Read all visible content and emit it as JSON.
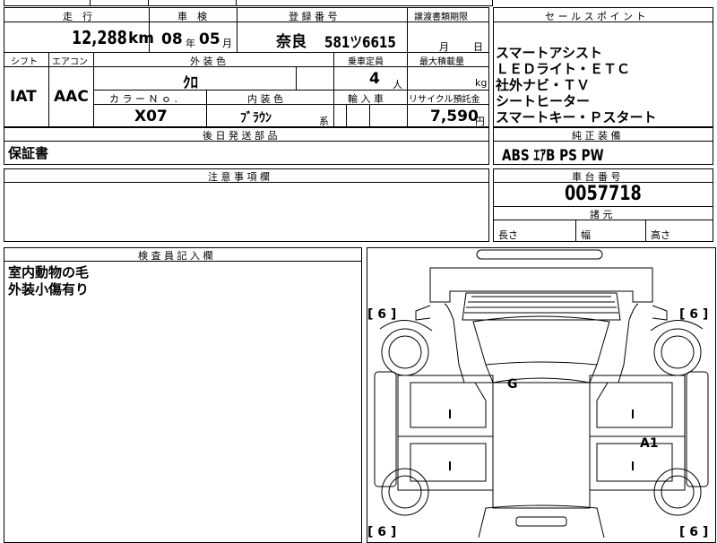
{
  "top_form": {
    "mileage_label": "走　行",
    "mileage_value": "12,288",
    "mileage_unit": "km",
    "inspection_label": "車　検",
    "inspection_year": "08",
    "inspection_year_unit": "年",
    "inspection_month": "05",
    "inspection_month_unit": "月",
    "registration_label": "登 録 番 号",
    "registration_area": "奈良",
    "registration_number": "581ツ6615",
    "transfer_deadline_label": "譲渡書類期限",
    "transfer_month_unit": "月",
    "transfer_day_unit": "日",
    "shift_label": "シフト",
    "shift_value": "IAT",
    "aircon_label": "エアコン",
    "aircon_value": "AAC",
    "exterior_color_label": "外 装 色",
    "exterior_color_value": "ｸﾛ",
    "capacity_label": "乗車定員",
    "capacity_value": "4",
    "capacity_unit": "人",
    "max_load_label": "最大積載量",
    "max_load_unit": "kg",
    "color_no_label": "カ ラ ー Ｎ ｏ .",
    "color_no_value": "X07",
    "interior_color_label": "内 装 色",
    "interior_color_value": "ﾌﾞﾗｳﾝ",
    "interior_color_suffix": "系",
    "import_label": "輸 入 車",
    "recycle_label": "リサイクル預託金",
    "recycle_value": "7,590",
    "recycle_unit": "円"
  },
  "sales_points": {
    "label": "セ ー ル ス ポ イ ン ト",
    "lines": [
      "スマートアシスト",
      "ＬＥＤライト・ＥＴＣ",
      "社外ナビ・ＴＶ",
      "シートヒーター",
      "スマートキー・Ｐスタート"
    ]
  },
  "later_parts": {
    "label": "後 日 発 送 部 品",
    "value": "保証書"
  },
  "genuine_equipment": {
    "label": "純 正 装 備",
    "value": "ABS ｴｱB PS PW"
  },
  "notes": {
    "label": "注 意 事 項 欄",
    "value": ""
  },
  "chassis": {
    "label": "車 台 番 号",
    "value": "0057718",
    "specs_label": "諸 元",
    "length_label": "長さ",
    "width_label": "幅",
    "height_label": "高さ"
  },
  "inspector": {
    "label": "検 査 員 記 入 欄",
    "lines": [
      "室内動物の毛",
      "外装小傷有り"
    ]
  },
  "diagram": {
    "tire_marks": {
      "front_left": "[ 6 ]",
      "front_right": "[ 6 ]",
      "rear_left": "[ 6 ]",
      "rear_right": "[ 6 ]"
    },
    "damage_codes": {
      "windshield": "G",
      "right_rear_door": "A1"
    }
  }
}
